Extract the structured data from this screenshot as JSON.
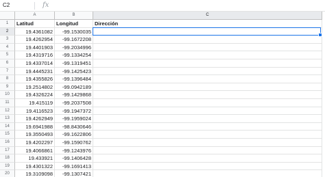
{
  "formula_bar": {
    "name_box": "C2",
    "fx_label": "fx",
    "formula": ""
  },
  "columns": [
    "A",
    "B",
    "C"
  ],
  "selected_cell": "C2",
  "rows": [
    {
      "num": "1",
      "cells": [
        "Latitud",
        "Longitud",
        "Dirección"
      ]
    },
    {
      "num": "2",
      "cells": [
        "19.4361082",
        "-99.1530035",
        ""
      ]
    },
    {
      "num": "3",
      "cells": [
        "19.4262954",
        "-99.1672208",
        ""
      ]
    },
    {
      "num": "4",
      "cells": [
        "19.4401903",
        "-99.2034996",
        ""
      ]
    },
    {
      "num": "5",
      "cells": [
        "19.4319716",
        "-99.1334254",
        ""
      ]
    },
    {
      "num": "6",
      "cells": [
        "19.4337014",
        "-99.1319451",
        ""
      ]
    },
    {
      "num": "7",
      "cells": [
        "19.4445231",
        "-99.1425423",
        ""
      ]
    },
    {
      "num": "8",
      "cells": [
        "19.4355826",
        "-99.1396484",
        ""
      ]
    },
    {
      "num": "9",
      "cells": [
        "19.2514802",
        "-99.0942189",
        ""
      ]
    },
    {
      "num": "10",
      "cells": [
        "19.4326224",
        "-99.1429868",
        ""
      ]
    },
    {
      "num": "11",
      "cells": [
        "19.415119",
        "-99.2037508",
        ""
      ]
    },
    {
      "num": "12",
      "cells": [
        "19.4116523",
        "-99.1947372",
        ""
      ]
    },
    {
      "num": "13",
      "cells": [
        "19.4262949",
        "-99.1959024",
        ""
      ]
    },
    {
      "num": "14",
      "cells": [
        "19.6941988",
        "-98.8430646",
        ""
      ]
    },
    {
      "num": "15",
      "cells": [
        "19.3550493",
        "-99.1622806",
        ""
      ]
    },
    {
      "num": "16",
      "cells": [
        "19.4202297",
        "-99.1590762",
        ""
      ]
    },
    {
      "num": "17",
      "cells": [
        "19.4066861",
        "-99.1243976",
        ""
      ]
    },
    {
      "num": "18",
      "cells": [
        "19.433921",
        "-99.1406428",
        ""
      ]
    },
    {
      "num": "19",
      "cells": [
        "19.4301322",
        "-99.1691413",
        ""
      ]
    },
    {
      "num": "20",
      "cells": [
        "19.3109098",
        "-99.1307421",
        ""
      ]
    }
  ]
}
